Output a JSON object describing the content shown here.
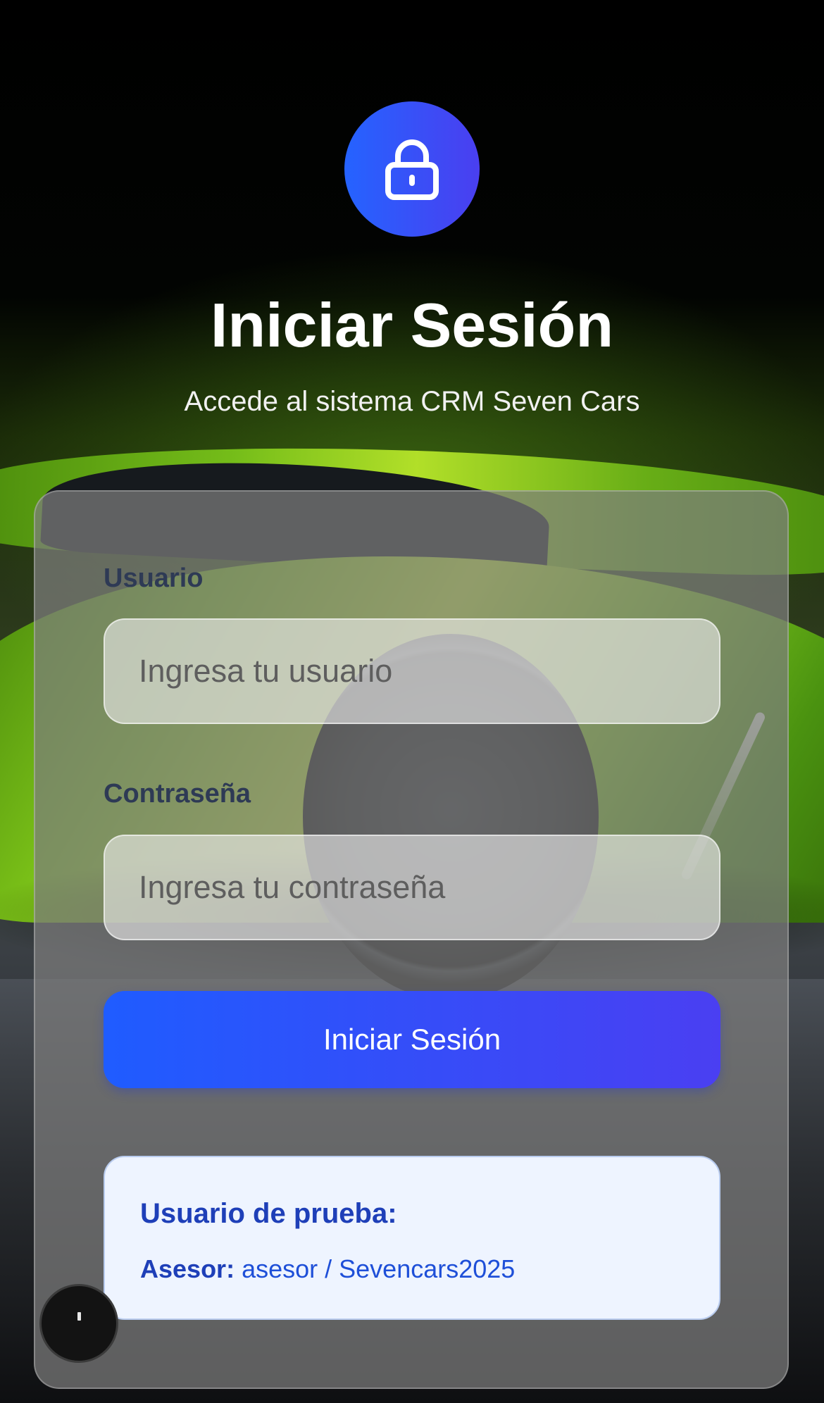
{
  "header": {
    "icon": "lock-icon",
    "title": "Iniciar Sesión",
    "subtitle": "Accede al sistema CRM Seven Cars"
  },
  "form": {
    "username_label": "Usuario",
    "username_placeholder": "Ingresa tu usuario",
    "username_value": "",
    "password_label": "Contraseña",
    "password_placeholder": "Ingresa tu contraseña",
    "password_value": "",
    "submit_label": "Iniciar Sesión"
  },
  "demo_box": {
    "title": "Usuario de prueba:",
    "role_label": "Asesor:",
    "credentials": "asesor / Sevencars2025"
  },
  "colors": {
    "accent_start": "#2563ff",
    "accent_end": "#4a3ff0",
    "demo_text": "#1e3fb8"
  }
}
